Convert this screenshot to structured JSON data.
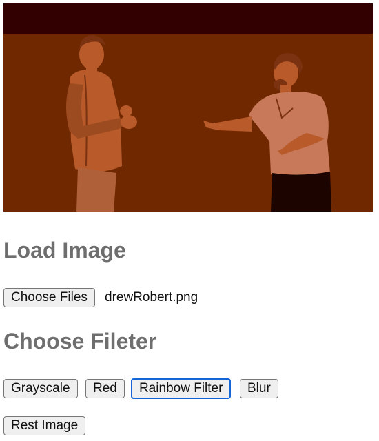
{
  "preview": {
    "description_icon": "image-preview",
    "colors": {
      "top_band": "#320000",
      "background": "#702800",
      "figure": "#b85a2a",
      "figure_dark": "#7a3211",
      "pants_dark": "#1c0400"
    }
  },
  "load_section": {
    "title": "Load Image",
    "choose_button_label": "Choose Files",
    "file_name": "drewRobert.png"
  },
  "filter_section": {
    "title": "Choose Fileter",
    "buttons": [
      "Grayscale",
      "Red",
      "Rainbow Filter",
      "Blur"
    ],
    "focused_button": "Rainbow Filter",
    "reset_label": "Rest Image"
  },
  "colors": {
    "heading": "#6e6e6e",
    "focus_ring": "#1565d8",
    "button_bg": "#efefef"
  }
}
